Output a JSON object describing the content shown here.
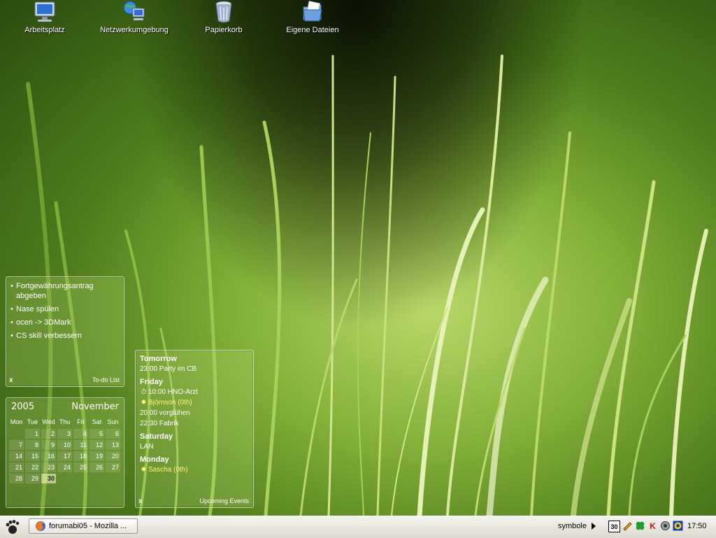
{
  "desktop_icons": [
    {
      "label": "Arbeitsplatz",
      "icon": "computer-icon"
    },
    {
      "label": "Netzwerkumgebung",
      "icon": "network-icon"
    },
    {
      "label": "Papierkorb",
      "icon": "recycle-bin-icon"
    },
    {
      "label": "Eigene Dateien",
      "icon": "documents-folder-icon"
    }
  ],
  "todo": {
    "items": [
      "Fortgewährungsantrag abgeben",
      "Nase spülen",
      "ocen -> 3DMark",
      "CS skill verbessern"
    ],
    "close": "x",
    "caption": "To-do List"
  },
  "calendar": {
    "year": "2005",
    "month": "November",
    "weekdays": [
      "Mon",
      "Tue",
      "Wed",
      "Thu",
      "Fri",
      "Sat",
      "Sun"
    ],
    "weeks": [
      [
        "",
        "1",
        "2",
        "3",
        "4",
        "5",
        "6"
      ],
      [
        "7",
        "8",
        "9",
        "10",
        "11",
        "12",
        "13"
      ],
      [
        "14",
        "15",
        "16",
        "17",
        "18",
        "19",
        "20"
      ],
      [
        "21",
        "22",
        "23",
        "24",
        "25",
        "26",
        "27"
      ],
      [
        "28",
        "29",
        "30",
        "",
        "",
        "",
        ""
      ]
    ],
    "today": "30"
  },
  "events": {
    "days": [
      {
        "day": "Tomorrow",
        "items": [
          {
            "text": "23:00 Party im CB",
            "type": "event"
          }
        ]
      },
      {
        "day": "Friday",
        "items": [
          {
            "text": "10:00 HNO-Arzt",
            "type": "alarm",
            "icon": "alarm-clock-icon"
          },
          {
            "text": "Björnson (0th)",
            "type": "birthday",
            "icon": "birthday-star-icon"
          },
          {
            "text": "20:00 vorglühen",
            "type": "event"
          },
          {
            "text": "22:30 Fabrik",
            "type": "event"
          }
        ]
      },
      {
        "day": "Saturday",
        "items": [
          {
            "text": "LAN",
            "type": "event"
          }
        ]
      },
      {
        "day": "Monday",
        "items": [
          {
            "text": "Sascha (0th)",
            "type": "birthday",
            "icon": "birthday-star-icon"
          }
        ]
      }
    ],
    "close": "x",
    "caption": "Upcoming Events"
  },
  "taskbar": {
    "start_icon": "gnome-foot-icon",
    "task_button": "forumabi05 - Mozilla ...",
    "task_icon": "firefox-icon",
    "tray_label": "symbole",
    "tray_icons": [
      {
        "icon": "calendar-30-icon",
        "text": "30"
      },
      {
        "icon": "pencil-icon",
        "text": ""
      },
      {
        "icon": "clover-icon",
        "text": ""
      },
      {
        "icon": "k-red-icon",
        "text": "K"
      },
      {
        "icon": "speaker-icon",
        "text": ""
      },
      {
        "icon": "target-icon",
        "text": ""
      }
    ],
    "clock": "17:50"
  },
  "colors": {
    "widget_bg": "#bee178",
    "birthday_text": "#fff27a",
    "taskbar_bg": "#ecebe5"
  }
}
